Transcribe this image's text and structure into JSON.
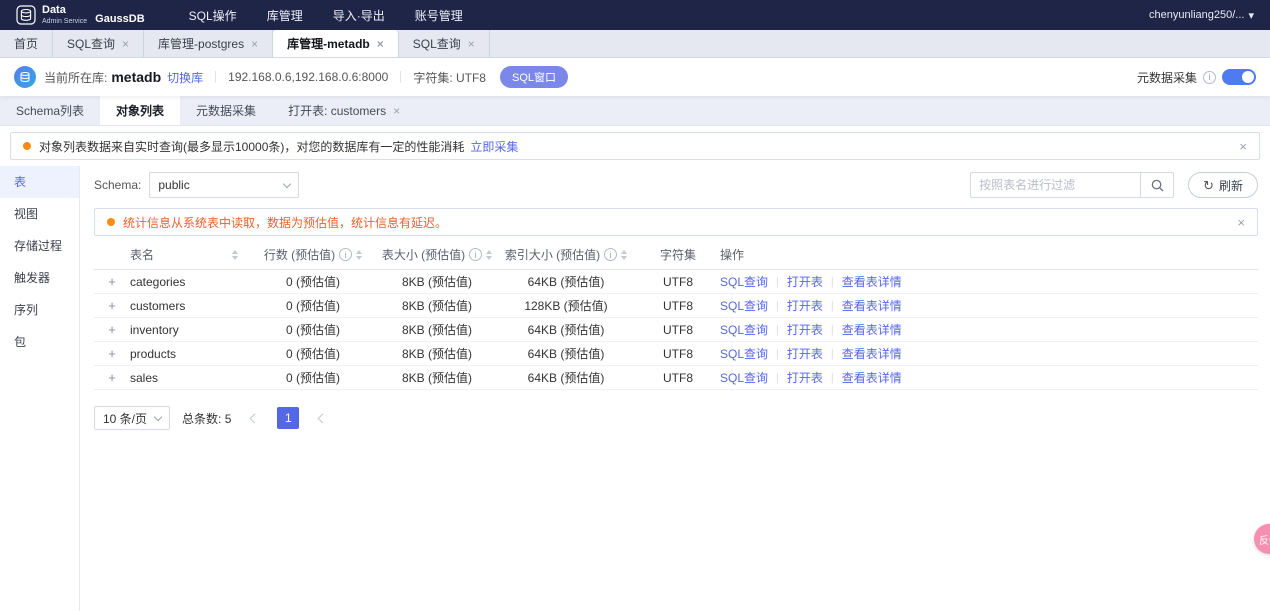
{
  "colors": {
    "accent": "#5567e9",
    "topbar_bg": "#1e2547",
    "warning_text": "#e8622d",
    "fab_pink": "#f68fb2",
    "toggle_on": "#4f7bf0",
    "notice_dot": "#fa8c16"
  },
  "icons": {
    "close": "×",
    "info": "i",
    "expand": "+",
    "refresh": "↻",
    "caret_down": "▾",
    "pipe": "|"
  },
  "topbar": {
    "brand_line1": "Data",
    "brand_line2": "Admin Service",
    "brand_product": "GaussDB",
    "menu": [
      "SQL操作",
      "库管理",
      "导入·导出",
      "账号管理"
    ],
    "user": "chenyunliang250/..."
  },
  "tabs": [
    {
      "label": "首页",
      "closable": false,
      "active": false
    },
    {
      "label": "SQL查询",
      "closable": true,
      "active": false
    },
    {
      "label": "库管理-postgres",
      "closable": true,
      "active": false
    },
    {
      "label": "库管理-metadb",
      "closable": true,
      "active": true
    },
    {
      "label": "SQL查询",
      "closable": true,
      "active": false
    }
  ],
  "infobar": {
    "db_label": "当前所在库:",
    "db_name": "metadb",
    "switch_link": "切换库",
    "address": "192.168.0.6,192.168.0.6:8000",
    "charset": "字符集: UTF8",
    "sql_window_button": "SQL窗口",
    "metadata_toggle_label": "元数据采集"
  },
  "subtabs": [
    {
      "label": "Schema列表",
      "active": false,
      "closable": false
    },
    {
      "label": "对象列表",
      "active": true,
      "closable": false
    },
    {
      "label": "元数据采集",
      "active": false,
      "closable": false
    },
    {
      "label": "打开表: customers",
      "active": false,
      "closable": true
    }
  ],
  "notice": {
    "text": "对象列表数据来自实时查询(最多显示10000条)，对您的数据库有一定的性能消耗",
    "link": "立即采集"
  },
  "sidebar": [
    {
      "label": "表",
      "active": true
    },
    {
      "label": "视图",
      "active": false
    },
    {
      "label": "存储过程",
      "active": false
    },
    {
      "label": "触发器",
      "active": false
    },
    {
      "label": "序列",
      "active": false
    },
    {
      "label": "包",
      "active": false
    }
  ],
  "toolbar": {
    "schema_label": "Schema:",
    "schema_value": "public",
    "filter_placeholder": "按照表名进行过滤",
    "refresh_label": "刷新"
  },
  "warning": {
    "text": "统计信息从系统表中读取，数据为预估值，统计信息有延迟。"
  },
  "table": {
    "headers": [
      "表名",
      "行数 (预估值)",
      "表大小 (预估值)",
      "索引大小 (预估值)",
      "字符集",
      "操作"
    ],
    "row_actions": [
      "SQL查询",
      "打开表",
      "查看表详情"
    ],
    "rows": [
      {
        "name": "categories",
        "row_count": "0 (预估值)",
        "table_size": "8KB (预估值)",
        "index_size": "64KB (预估值)",
        "charset": "UTF8"
      },
      {
        "name": "customers",
        "row_count": "0 (预估值)",
        "table_size": "8KB (预估值)",
        "index_size": "128KB (预估值)",
        "charset": "UTF8"
      },
      {
        "name": "inventory",
        "row_count": "0 (预估值)",
        "table_size": "8KB (预估值)",
        "index_size": "64KB (预估值)",
        "charset": "UTF8"
      },
      {
        "name": "products",
        "row_count": "0 (预估值)",
        "table_size": "8KB (预估值)",
        "index_size": "64KB (预估值)",
        "charset": "UTF8"
      },
      {
        "name": "sales",
        "row_count": "0 (预估值)",
        "table_size": "8KB (预估值)",
        "index_size": "64KB (预估值)",
        "charset": "UTF8"
      }
    ]
  },
  "pagination": {
    "page_size": "10 条/页",
    "total_label": "总条数: 5",
    "current": "1"
  },
  "fab_label": "反馈"
}
